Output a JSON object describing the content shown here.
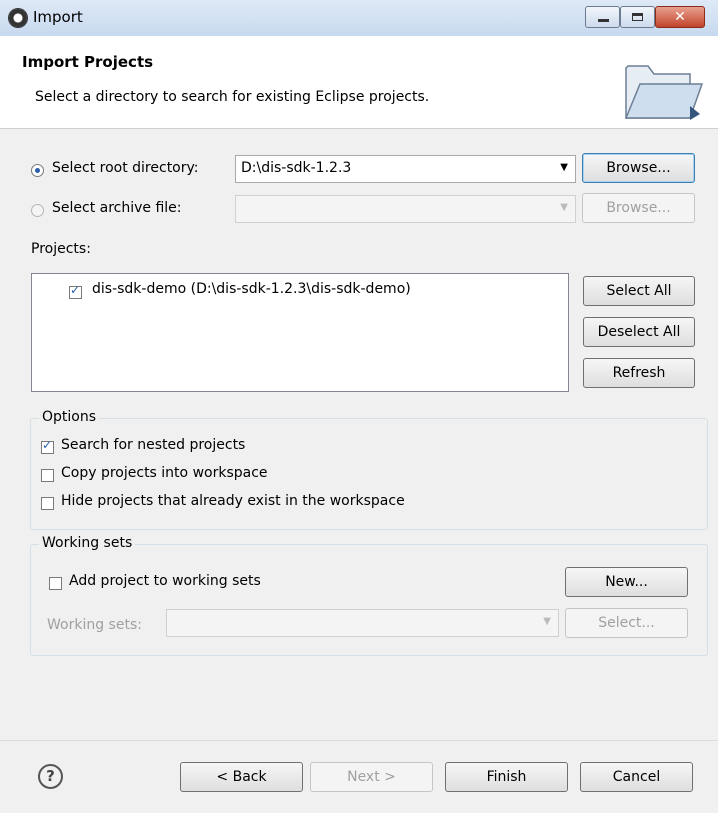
{
  "window": {
    "title": "Import"
  },
  "header": {
    "title": "Import Projects",
    "description": "Select a directory to search for existing Eclipse projects."
  },
  "source": {
    "root_label": "Select root directory:",
    "root_value": "D:\\dis-sdk-1.2.3",
    "root_selected": true,
    "archive_label": "Select archive file:",
    "archive_value": "",
    "browse_label": "Browse...",
    "browse_archive_label": "Browse..."
  },
  "projects": {
    "label": "Projects:",
    "items": [
      {
        "label": "dis-sdk-demo (D:\\dis-sdk-1.2.3\\dis-sdk-demo)",
        "checked": true
      }
    ],
    "select_all": "Select All",
    "deselect_all": "Deselect All",
    "refresh": "Refresh"
  },
  "options": {
    "title": "Options",
    "nested": {
      "label": "Search for nested projects",
      "checked": true
    },
    "copy": {
      "label": "Copy projects into workspace",
      "checked": false
    },
    "hide": {
      "label": "Hide projects that already exist in the workspace",
      "checked": false
    }
  },
  "working_sets": {
    "title": "Working sets",
    "add": {
      "label": "Add project to working sets",
      "checked": false
    },
    "new_button": "New...",
    "sets_label": "Working sets:",
    "sets_value": "",
    "select_button": "Select..."
  },
  "footer": {
    "help_icon": "question-icon",
    "back": "< Back",
    "next": "Next >",
    "finish": "Finish",
    "cancel": "Cancel"
  }
}
